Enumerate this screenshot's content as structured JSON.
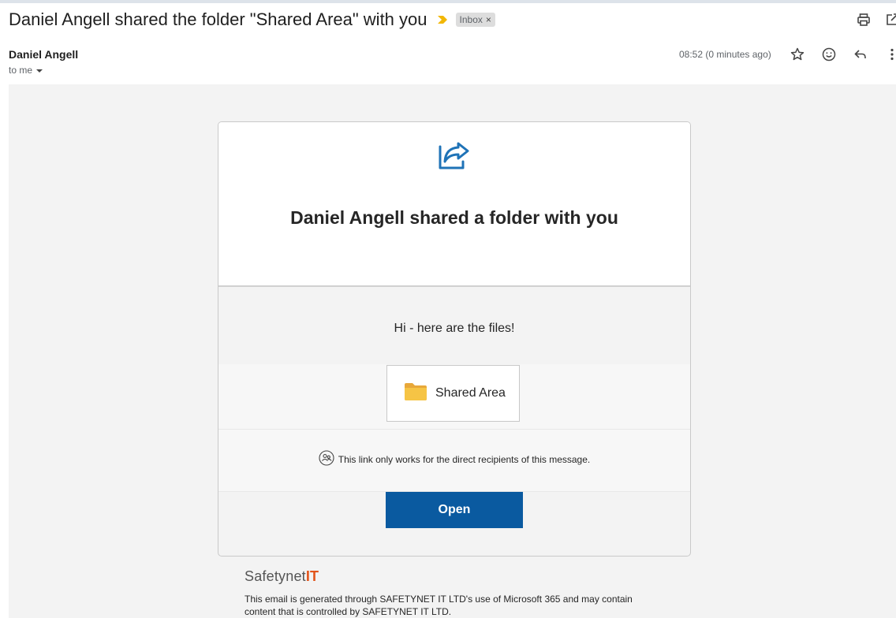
{
  "subject": "Daniel Angell shared the folder \"Shared Area\" with you",
  "label": {
    "name": "Inbox",
    "remove": "×"
  },
  "sender": "Daniel Angell",
  "recipient": "to me",
  "time": "08:52 (0 minutes ago)",
  "icons": {
    "importance": "importance-marker-icon",
    "print": "print-icon",
    "new_window": "open-in-new-window-icon",
    "star": "star-icon",
    "emoji": "emoji-reaction-icon",
    "reply": "reply-icon",
    "more": "more-vert-icon",
    "share": "share-icon",
    "folder": "folder-icon",
    "people": "people-icon"
  },
  "colors": {
    "accent": "#0a5aa0",
    "brand_it": "#e2541b",
    "share_icon": "#1f73b7",
    "folder": "#f6c445"
  },
  "card": {
    "title": "Daniel Angell shared a folder with you",
    "message": "Hi - here are the files!",
    "folder_name": "Shared Area",
    "notice": "This link only works for the direct recipients of this message.",
    "open_label": "Open"
  },
  "brand": {
    "name": "Safetynet",
    "suffix": "IT"
  },
  "footer": "This email is generated through SAFETYNET IT LTD's use of Microsoft 365 and may contain content that is controlled by SAFETYNET IT LTD."
}
